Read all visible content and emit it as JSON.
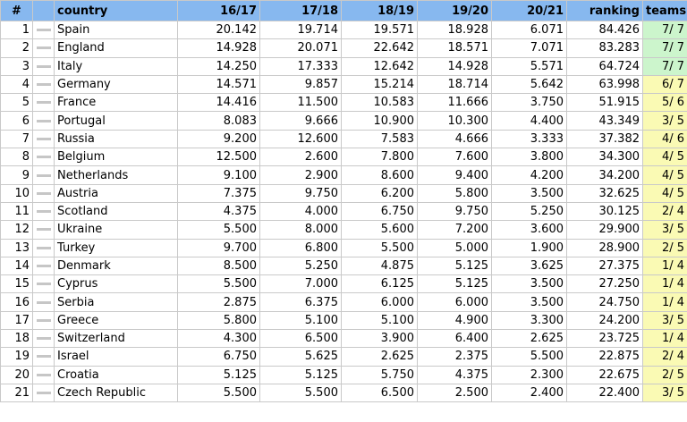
{
  "columns": {
    "rank": "#",
    "country": "country",
    "s1617": "16/17",
    "s1718": "17/18",
    "s1819": "18/19",
    "s1920": "19/20",
    "s2021": "20/21",
    "ranking": "ranking",
    "teams": "teams"
  },
  "colors": {
    "header_bg": "#87b8ef",
    "teams_full": "#ccf5cc",
    "teams_partial": "#fafab4",
    "position_unchanged": "#c6c6c6"
  },
  "rows": [
    {
      "rank": "1",
      "move_icon": "dash-icon",
      "country": "Spain",
      "s1617": "20.142",
      "s1718": "19.714",
      "s1819": "19.571",
      "s1920": "18.928",
      "s2021": "6.071",
      "ranking": "84.426",
      "teams": "7/ 7",
      "teams_status": "full"
    },
    {
      "rank": "2",
      "move_icon": "dash-icon",
      "country": "England",
      "s1617": "14.928",
      "s1718": "20.071",
      "s1819": "22.642",
      "s1920": "18.571",
      "s2021": "7.071",
      "ranking": "83.283",
      "teams": "7/ 7",
      "teams_status": "full"
    },
    {
      "rank": "3",
      "move_icon": "dash-icon",
      "country": "Italy",
      "s1617": "14.250",
      "s1718": "17.333",
      "s1819": "12.642",
      "s1920": "14.928",
      "s2021": "5.571",
      "ranking": "64.724",
      "teams": "7/ 7",
      "teams_status": "full"
    },
    {
      "rank": "4",
      "move_icon": "dash-icon",
      "country": "Germany",
      "s1617": "14.571",
      "s1718": "9.857",
      "s1819": "15.214",
      "s1920": "18.714",
      "s2021": "5.642",
      "ranking": "63.998",
      "teams": "6/ 7",
      "teams_status": "partial"
    },
    {
      "rank": "5",
      "move_icon": "dash-icon",
      "country": "France",
      "s1617": "14.416",
      "s1718": "11.500",
      "s1819": "10.583",
      "s1920": "11.666",
      "s2021": "3.750",
      "ranking": "51.915",
      "teams": "5/ 6",
      "teams_status": "partial"
    },
    {
      "rank": "6",
      "move_icon": "dash-icon",
      "country": "Portugal",
      "s1617": "8.083",
      "s1718": "9.666",
      "s1819": "10.900",
      "s1920": "10.300",
      "s2021": "4.400",
      "ranking": "43.349",
      "teams": "3/ 5",
      "teams_status": "partial"
    },
    {
      "rank": "7",
      "move_icon": "dash-icon",
      "country": "Russia",
      "s1617": "9.200",
      "s1718": "12.600",
      "s1819": "7.583",
      "s1920": "4.666",
      "s2021": "3.333",
      "ranking": "37.382",
      "teams": "4/ 6",
      "teams_status": "partial"
    },
    {
      "rank": "8",
      "move_icon": "dash-icon",
      "country": "Belgium",
      "s1617": "12.500",
      "s1718": "2.600",
      "s1819": "7.800",
      "s1920": "7.600",
      "s2021": "3.800",
      "ranking": "34.300",
      "teams": "4/ 5",
      "teams_status": "partial"
    },
    {
      "rank": "9",
      "move_icon": "dash-icon",
      "country": "Netherlands",
      "s1617": "9.100",
      "s1718": "2.900",
      "s1819": "8.600",
      "s1920": "9.400",
      "s2021": "4.200",
      "ranking": "34.200",
      "teams": "4/ 5",
      "teams_status": "partial"
    },
    {
      "rank": "10",
      "move_icon": "dash-icon",
      "country": "Austria",
      "s1617": "7.375",
      "s1718": "9.750",
      "s1819": "6.200",
      "s1920": "5.800",
      "s2021": "3.500",
      "ranking": "32.625",
      "teams": "4/ 5",
      "teams_status": "partial"
    },
    {
      "rank": "11",
      "move_icon": "dash-icon",
      "country": "Scotland",
      "s1617": "4.375",
      "s1718": "4.000",
      "s1819": "6.750",
      "s1920": "9.750",
      "s2021": "5.250",
      "ranking": "30.125",
      "teams": "2/ 4",
      "teams_status": "partial"
    },
    {
      "rank": "12",
      "move_icon": "dash-icon",
      "country": "Ukraine",
      "s1617": "5.500",
      "s1718": "8.000",
      "s1819": "5.600",
      "s1920": "7.200",
      "s2021": "3.600",
      "ranking": "29.900",
      "teams": "3/ 5",
      "teams_status": "partial"
    },
    {
      "rank": "13",
      "move_icon": "dash-icon",
      "country": "Turkey",
      "s1617": "9.700",
      "s1718": "6.800",
      "s1819": "5.500",
      "s1920": "5.000",
      "s2021": "1.900",
      "ranking": "28.900",
      "teams": "2/ 5",
      "teams_status": "partial"
    },
    {
      "rank": "14",
      "move_icon": "dash-icon",
      "country": "Denmark",
      "s1617": "8.500",
      "s1718": "5.250",
      "s1819": "4.875",
      "s1920": "5.125",
      "s2021": "3.625",
      "ranking": "27.375",
      "teams": "1/ 4",
      "teams_status": "partial"
    },
    {
      "rank": "15",
      "move_icon": "dash-icon",
      "country": "Cyprus",
      "s1617": "5.500",
      "s1718": "7.000",
      "s1819": "6.125",
      "s1920": "5.125",
      "s2021": "3.500",
      "ranking": "27.250",
      "teams": "1/ 4",
      "teams_status": "partial"
    },
    {
      "rank": "16",
      "move_icon": "dash-icon",
      "country": "Serbia",
      "s1617": "2.875",
      "s1718": "6.375",
      "s1819": "6.000",
      "s1920": "6.000",
      "s2021": "3.500",
      "ranking": "24.750",
      "teams": "1/ 4",
      "teams_status": "partial"
    },
    {
      "rank": "17",
      "move_icon": "dash-icon",
      "country": "Greece",
      "s1617": "5.800",
      "s1718": "5.100",
      "s1819": "5.100",
      "s1920": "4.900",
      "s2021": "3.300",
      "ranking": "24.200",
      "teams": "3/ 5",
      "teams_status": "partial"
    },
    {
      "rank": "18",
      "move_icon": "dash-icon",
      "country": "Switzerland",
      "s1617": "4.300",
      "s1718": "6.500",
      "s1819": "3.900",
      "s1920": "6.400",
      "s2021": "2.625",
      "ranking": "23.725",
      "teams": "1/ 4",
      "teams_status": "partial"
    },
    {
      "rank": "19",
      "move_icon": "dash-icon",
      "country": "Israel",
      "s1617": "6.750",
      "s1718": "5.625",
      "s1819": "2.625",
      "s1920": "2.375",
      "s2021": "5.500",
      "ranking": "22.875",
      "teams": "2/ 4",
      "teams_status": "partial"
    },
    {
      "rank": "20",
      "move_icon": "dash-icon",
      "country": "Croatia",
      "s1617": "5.125",
      "s1718": "5.125",
      "s1819": "5.750",
      "s1920": "4.375",
      "s2021": "2.300",
      "ranking": "22.675",
      "teams": "2/ 5",
      "teams_status": "partial"
    },
    {
      "rank": "21",
      "move_icon": "dash-icon",
      "country": "Czech Republic",
      "s1617": "5.500",
      "s1718": "5.500",
      "s1819": "6.500",
      "s1920": "2.500",
      "s2021": "2.400",
      "ranking": "22.400",
      "teams": "3/ 5",
      "teams_status": "partial"
    }
  ]
}
